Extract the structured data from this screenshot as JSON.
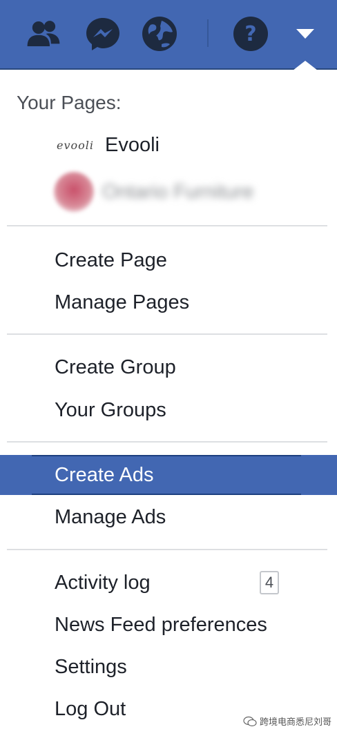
{
  "topbar": {
    "icons": [
      "friends-icon",
      "messenger-icon",
      "notifications-globe-icon",
      "help-icon",
      "account-menu-caret-icon"
    ],
    "colors": {
      "bar": "#4267b2",
      "icon": "#1d2a40"
    }
  },
  "menu": {
    "section_title": "Your Pages:",
    "pages": [
      {
        "logo_text": "evooli",
        "name": "Evooli"
      },
      {
        "name": "Ontario Furniture"
      }
    ],
    "group1": [
      {
        "label": "Create Page"
      },
      {
        "label": "Manage Pages"
      }
    ],
    "group2": [
      {
        "label": "Create Group"
      },
      {
        "label": "Your Groups"
      }
    ],
    "group3": [
      {
        "label": "Create Ads",
        "active": true
      },
      {
        "label": "Manage Ads"
      }
    ],
    "group4": [
      {
        "label": "Activity log",
        "badge": "4"
      },
      {
        "label": "News Feed preferences"
      },
      {
        "label": "Settings"
      },
      {
        "label": "Log Out"
      }
    ]
  },
  "watermark": {
    "text": "跨境电商悉尼刘哥"
  }
}
